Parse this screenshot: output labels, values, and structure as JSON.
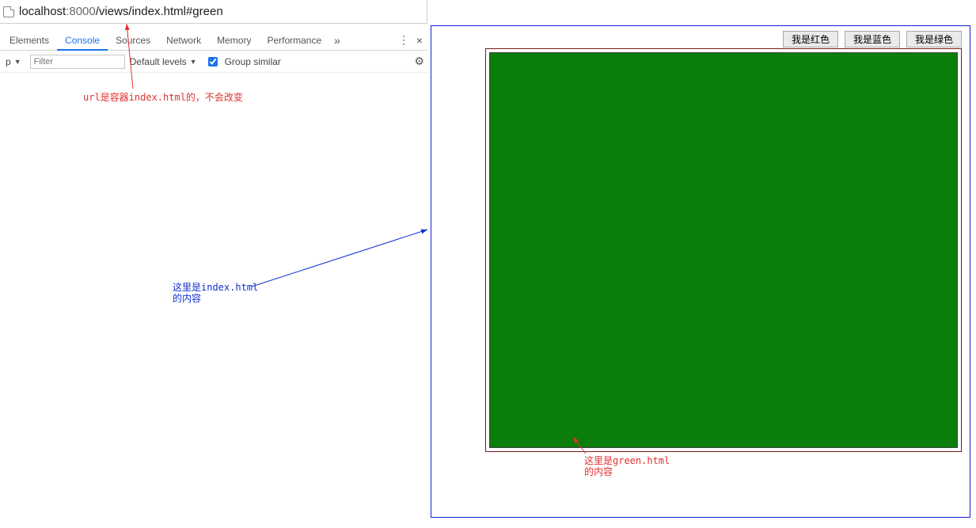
{
  "address": {
    "host": "localhost",
    "port": ":8000",
    "path": "/views/index.html#green"
  },
  "devtools": {
    "tabs": [
      "Elements",
      "Console",
      "Sources",
      "Network",
      "Memory",
      "Performance"
    ],
    "activeIndex": 1,
    "ctxLabel": "p",
    "filterPlaceholder": "Filter",
    "levelsLabel": "Default levels",
    "groupSimilar": "Group similar"
  },
  "page": {
    "buttons": [
      "我是红色",
      "我是蓝色",
      "我是绿色"
    ],
    "colors": {
      "index_border": "#1020d0",
      "inner_border": "#7a1a1a",
      "fill": "#0b7d0b"
    }
  },
  "annotations": {
    "url_note": "url是容器index.html的，不会改变",
    "index_note": "这里是index.html\n的内容",
    "green_note": "这里是green.html\n的内容"
  }
}
